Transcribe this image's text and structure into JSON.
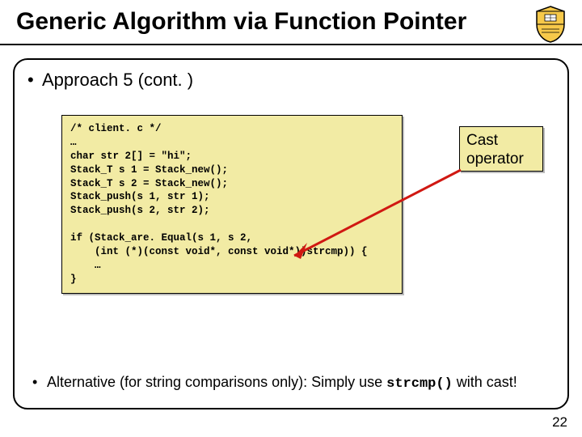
{
  "title": "Generic Algorithm via Function Pointer",
  "bullet1": "Approach 5 (cont. )",
  "code": "/* client. c */\n…\nchar str 2[] = \"hi\";\nStack_T s 1 = Stack_new();\nStack_T s 2 = Stack_new();\nStack_push(s 1, str 1);\nStack_push(s 2, str 2);\n\nif (Stack_are. Equal(s 1, s 2,\n    (int (*)(const void*, const void*))strcmp)) {\n    …\n}",
  "callout": {
    "line1": "Cast",
    "line2": "operator"
  },
  "alt": {
    "prefix": "Alternative (for string comparisons only): Simply use ",
    "code": "strcmp()",
    "suffix": " with cast!"
  },
  "page": "22"
}
